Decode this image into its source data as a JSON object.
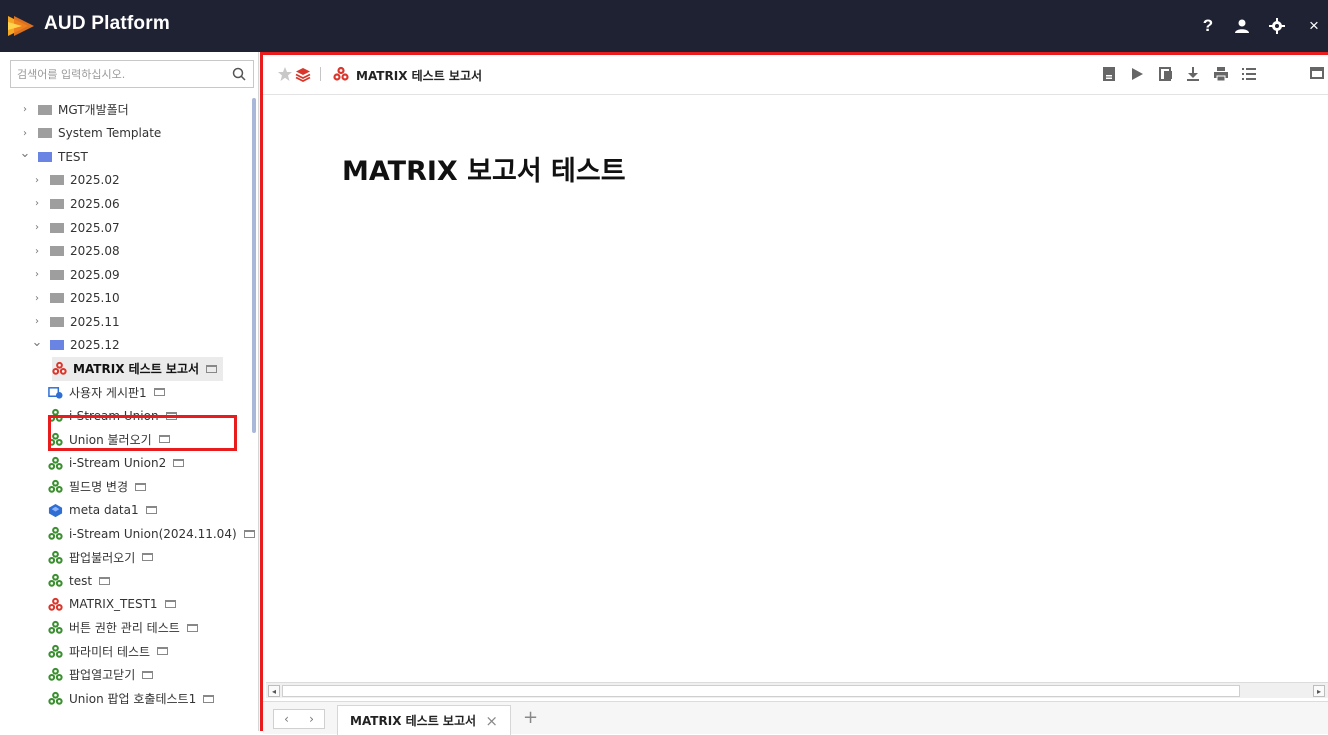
{
  "header": {
    "title": "AUD Platform",
    "help_label": "?",
    "user_icon": "user-icon",
    "settings_icon": "gear-icon",
    "close_label": "×"
  },
  "sidebar": {
    "search_placeholder": "검색어를 입력하십시오.",
    "tree": [
      {
        "label": "MGT개발폴더",
        "type": "folder",
        "level": 0,
        "expanded": false
      },
      {
        "label": "System Template",
        "type": "folder",
        "level": 0,
        "expanded": false
      },
      {
        "label": "TEST",
        "type": "folder",
        "level": 0,
        "expanded": true
      },
      {
        "label": "2025.02",
        "type": "folder",
        "level": 1,
        "expanded": false
      },
      {
        "label": "2025.06",
        "type": "folder",
        "level": 1,
        "expanded": false
      },
      {
        "label": "2025.07",
        "type": "folder",
        "level": 1,
        "expanded": false
      },
      {
        "label": "2025.08",
        "type": "folder",
        "level": 1,
        "expanded": false
      },
      {
        "label": "2025.09",
        "type": "folder",
        "level": 1,
        "expanded": false
      },
      {
        "label": "2025.10",
        "type": "folder",
        "level": 1,
        "expanded": false
      },
      {
        "label": "2025.11",
        "type": "folder",
        "level": 1,
        "expanded": false
      },
      {
        "label": "2025.12",
        "type": "folder",
        "level": 1,
        "expanded": true
      },
      {
        "label": "MATRIX 테스트 보고서",
        "type": "matrix-report",
        "level": 2,
        "selected": true
      },
      {
        "label": "사용자 게시판1",
        "type": "board",
        "level": 2
      },
      {
        "label": "i-Stream Union",
        "type": "report",
        "level": 2
      },
      {
        "label": "Union 불러오기",
        "type": "report",
        "level": 2
      },
      {
        "label": "i-Stream Union2",
        "type": "report",
        "level": 2
      },
      {
        "label": "필드명 변경",
        "type": "report",
        "level": 2
      },
      {
        "label": "meta data1",
        "type": "meta",
        "level": 2
      },
      {
        "label": "i-Stream Union(2024.11.04)",
        "type": "report",
        "level": 2
      },
      {
        "label": "팝업불러오기",
        "type": "report",
        "level": 2
      },
      {
        "label": "test",
        "type": "report",
        "level": 2
      },
      {
        "label": "MATRIX_TEST1",
        "type": "matrix-report",
        "level": 2
      },
      {
        "label": "버튼 권한 관리 테스트",
        "type": "report",
        "level": 2
      },
      {
        "label": "파라미터 테스트",
        "type": "report",
        "level": 2
      },
      {
        "label": "팝업열고닫기",
        "type": "report",
        "level": 2
      },
      {
        "label": "Union 팝업 호출테스트1",
        "type": "report",
        "level": 2
      }
    ]
  },
  "main": {
    "toolbar_title": "MATRIX 테스트 보고서",
    "toolbar_icons": [
      "save-icon",
      "run-icon",
      "export-icon",
      "download-icon",
      "print-icon",
      "list-icon",
      "window-icon"
    ],
    "report_heading": "MATRIX 보고서 테스트",
    "tab_nav_prev": "‹",
    "tab_nav_next": "›",
    "tabs": [
      {
        "label": "MATRIX 테스트 보고서",
        "close": "×"
      }
    ],
    "tab_add": "+"
  },
  "colors": {
    "header_bg": "#1f2233",
    "highlight_red": "#e81c1c",
    "folder_gray": "#9e9e9e",
    "folder_blue": "#6a84e4",
    "report_green": "#3a8f2e",
    "matrix_red": "#d9372c"
  }
}
